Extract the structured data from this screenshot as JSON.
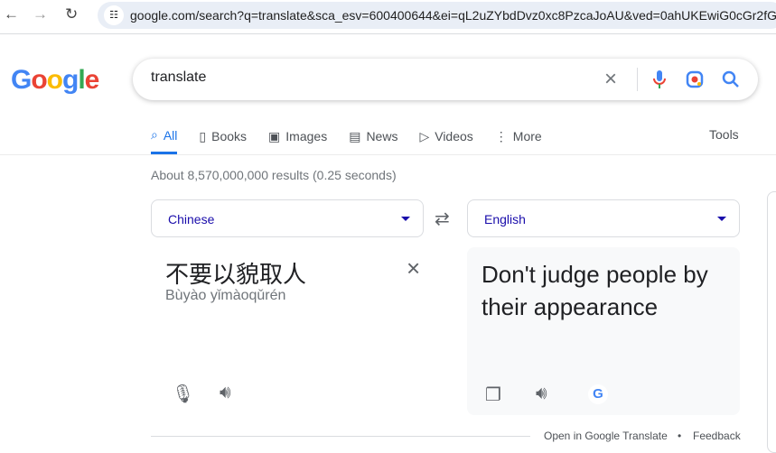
{
  "browser": {
    "url": "google.com/search?q=translate&sca_esv=600400644&ei=qL2uZYbdDvz0xc8PzcaJoAU&ved=0ahUKEwiG0cGr2fGDA"
  },
  "logo": "Google",
  "search": {
    "query": "translate"
  },
  "tabs": [
    {
      "label": "All",
      "icon": "search-icon"
    },
    {
      "label": "Books",
      "icon": "book-icon"
    },
    {
      "label": "Images",
      "icon": "image-icon"
    },
    {
      "label": "News",
      "icon": "news-icon"
    },
    {
      "label": "Videos",
      "icon": "video-icon"
    },
    {
      "label": "More",
      "icon": "more-vert-icon"
    }
  ],
  "tools": "Tools",
  "stats": "About 8,570,000,000 results (0.25 seconds)",
  "translate": {
    "source_lang": "Chinese",
    "target_lang": "English",
    "source_text": "不要以貌取人",
    "pinyin": "Bùyào yǐmàoqǔrén",
    "output_text": "Don't judge people by their appearance"
  },
  "footer": {
    "open": "Open in Google Translate",
    "sep": "•",
    "feedback": "Feedback"
  },
  "colors": {
    "accent": "#1a73e8",
    "link": "#1a0dab"
  }
}
